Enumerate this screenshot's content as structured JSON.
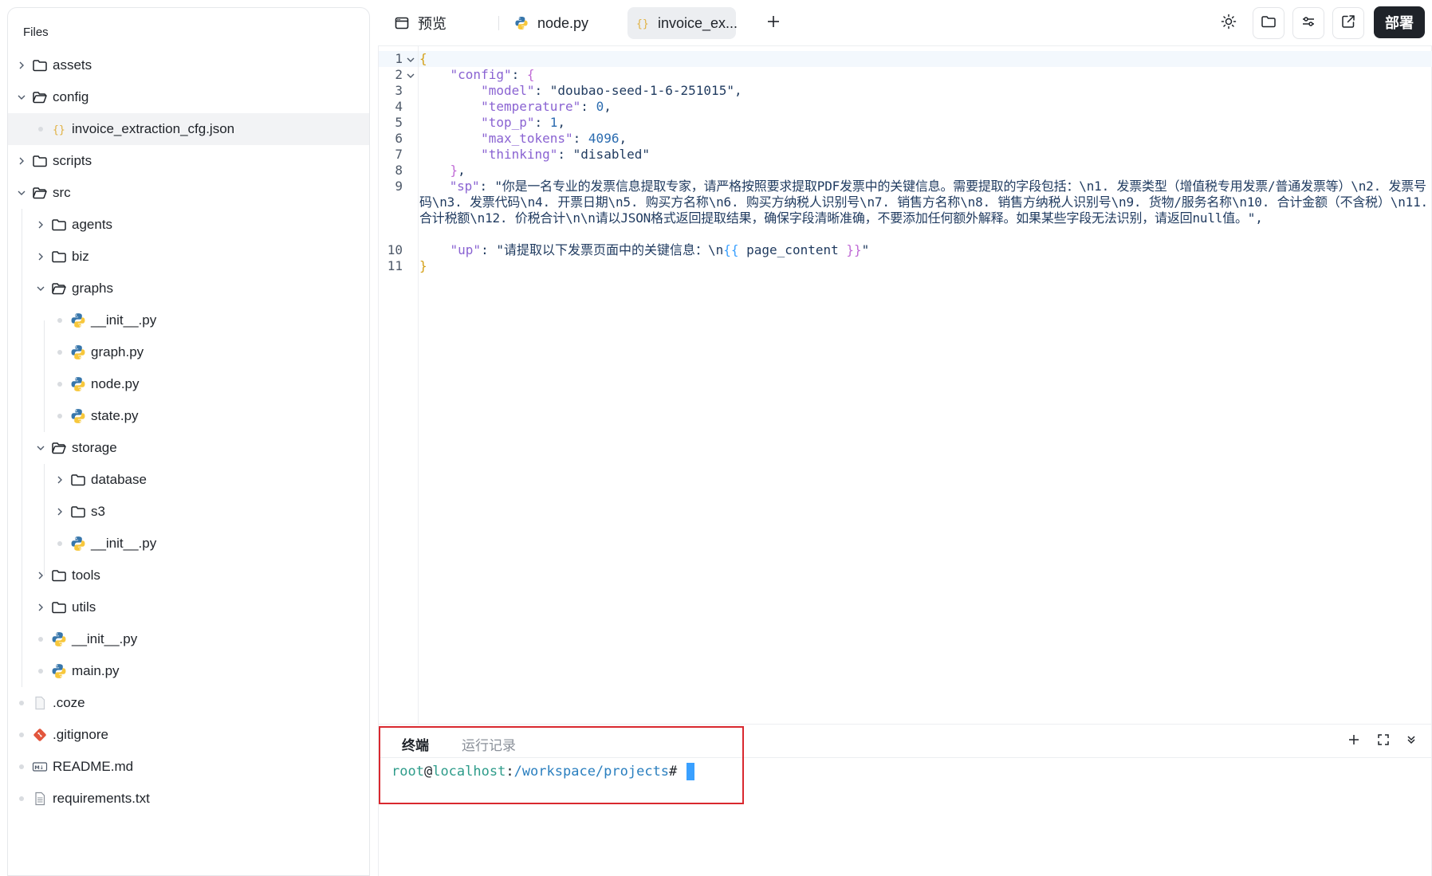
{
  "sidebar": {
    "title": "Files",
    "items": [
      {
        "label": "assets",
        "type": "folder",
        "open": false
      },
      {
        "label": "config",
        "type": "folder",
        "open": true
      },
      {
        "label": "invoice_extraction_cfg.json",
        "type": "json"
      },
      {
        "label": "scripts",
        "type": "folder",
        "open": false
      },
      {
        "label": "src",
        "type": "folder",
        "open": true
      },
      {
        "label": "agents",
        "type": "folder",
        "open": false
      },
      {
        "label": "biz",
        "type": "folder",
        "open": false
      },
      {
        "label": "graphs",
        "type": "folder",
        "open": true
      },
      {
        "label": "__init__.py",
        "type": "python"
      },
      {
        "label": "graph.py",
        "type": "python"
      },
      {
        "label": "node.py",
        "type": "python"
      },
      {
        "label": "state.py",
        "type": "python"
      },
      {
        "label": "storage",
        "type": "folder",
        "open": true
      },
      {
        "label": "database",
        "type": "folder",
        "open": false
      },
      {
        "label": "s3",
        "type": "folder",
        "open": false
      },
      {
        "label": "__init__.py",
        "type": "python"
      },
      {
        "label": "tools",
        "type": "folder",
        "open": false
      },
      {
        "label": "utils",
        "type": "folder",
        "open": false
      },
      {
        "label": "__init__.py",
        "type": "python"
      },
      {
        "label": "main.py",
        "type": "python"
      },
      {
        "label": ".coze",
        "type": "file"
      },
      {
        "label": ".gitignore",
        "type": "git"
      },
      {
        "label": "README.md",
        "type": "markdown"
      },
      {
        "label": "requirements.txt",
        "type": "text"
      }
    ]
  },
  "tabs": [
    {
      "label": "预览",
      "icon": "browser-window-icon"
    },
    {
      "label": "node.py",
      "icon": "python-icon"
    },
    {
      "label": "invoice_ex...",
      "icon": "json-icon",
      "active": true
    }
  ],
  "toolbar": {
    "deploy_label": "部署",
    "icons": [
      "add-tab-icon",
      "sun-icon",
      "folder-icon",
      "settings-sliders-icon",
      "external-link-icon"
    ]
  },
  "editor": {
    "line_numbers": [
      "1",
      "2",
      "3",
      "4",
      "5",
      "6",
      "7",
      "8",
      "9",
      "10",
      "11"
    ],
    "lines": {
      "l1": "{",
      "config_key": "\"config\"",
      "model_key": "\"model\"",
      "model_val": "\"doubao-seed-1-6-251015\"",
      "temperature_key": "\"temperature\"",
      "temperature_val": "0",
      "top_p_key": "\"top_p\"",
      "top_p_val": "1",
      "max_tokens_key": "\"max_tokens\"",
      "max_tokens_val": "4096",
      "thinking_key": "\"thinking\"",
      "thinking_val": "\"disabled\"",
      "sp_key": "\"sp\"",
      "sp_val": "\"你是一名专业的发票信息提取专家，请严格按照要求提取PDF发票中的关键信息。需要提取的字段包括：\\n1. 发票类型（增值税专用发票/普通发票等）\\n2. 发票号码\\n3. 发票代码\\n4. 开票日期\\n5. 购买方名称\\n6. 购买方纳税人识别号\\n7. 销售方名称\\n8. 销售方纳税人识别号\\n9. 货物/服务名称\\n10. 合计金额（不含税）\\n11. 合计税额\\n12. 价税合计\\n\\n请以JSON格式返回提取结果，确保字段清晰准确，不要添加任何额外解释。如果某些字段无法识别，请返回null值。\"",
      "up_key": "\"up\"",
      "up_val_prefix": "\"请提取以下发票页面中的关键信息：\\n",
      "up_var": "page_content",
      "l11": "}"
    }
  },
  "terminal": {
    "tabs": [
      "终端",
      "运行记录"
    ],
    "prompt_user": "root",
    "prompt_at": "@",
    "prompt_host": "localhost",
    "prompt_colon": ":",
    "prompt_path": "/workspace/projects",
    "prompt_hash": "#"
  },
  "colors": {
    "accent": "#3aa0ff",
    "highlight_border": "#d9282f",
    "deploy_bg": "#1f2329"
  }
}
